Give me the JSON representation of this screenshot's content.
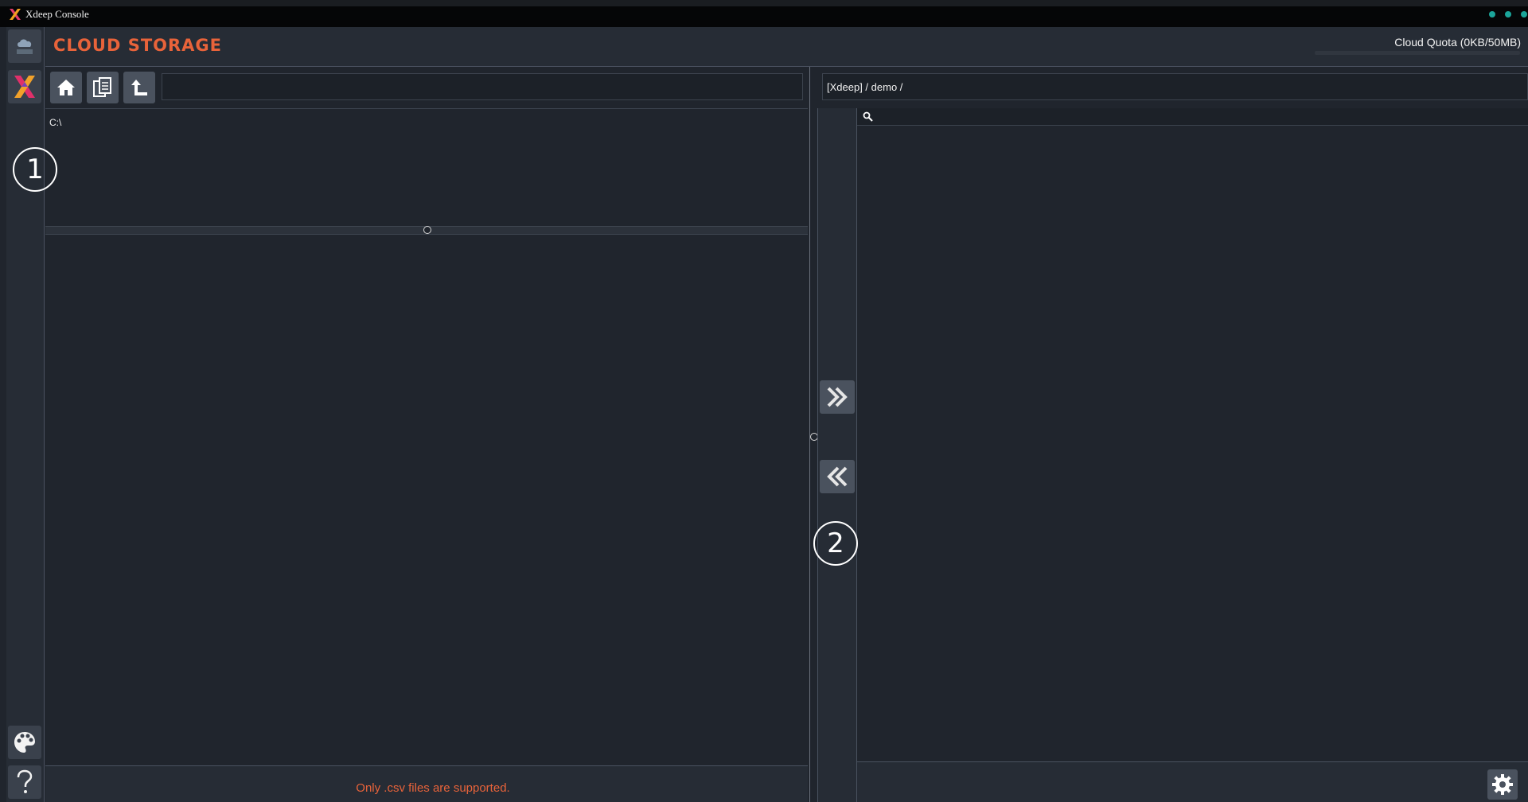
{
  "window": {
    "title": "Xdeep Console",
    "accent_color": "#e8633a",
    "status_dot_color": "#1ba59a"
  },
  "header": {
    "title": "CLOUD STORAGE",
    "quota_label": "Cloud Quota (0KB/50MB)",
    "quota_used_fraction": 0
  },
  "sidebar": {
    "items": [
      {
        "name": "cloud-storage-nav",
        "icon": "cloud-icon"
      },
      {
        "name": "xdeep-app-nav",
        "icon": "xdeep-logo-icon"
      },
      {
        "name": "theme-button",
        "icon": "palette-icon"
      },
      {
        "name": "help-button",
        "icon": "question-icon"
      }
    ]
  },
  "local_pane": {
    "toolbar": [
      {
        "name": "home-button",
        "icon": "home-icon"
      },
      {
        "name": "copy-path-button",
        "icon": "documents-icon"
      },
      {
        "name": "up-folder-button",
        "icon": "up-arrow-icon"
      }
    ],
    "path_value": "",
    "tree_root": "C:\\",
    "footer_note": "Only .csv files are supported."
  },
  "transfer": {
    "upload_icon": "double-chevron-right-icon",
    "download_icon": "double-chevron-left-icon"
  },
  "cloud_pane": {
    "path": "[Xdeep] / demo /",
    "search_icon": "search-icon",
    "search_value": "",
    "settings_icon": "gear-icon"
  },
  "annotations": {
    "callout_1": "1",
    "callout_2": "2"
  }
}
